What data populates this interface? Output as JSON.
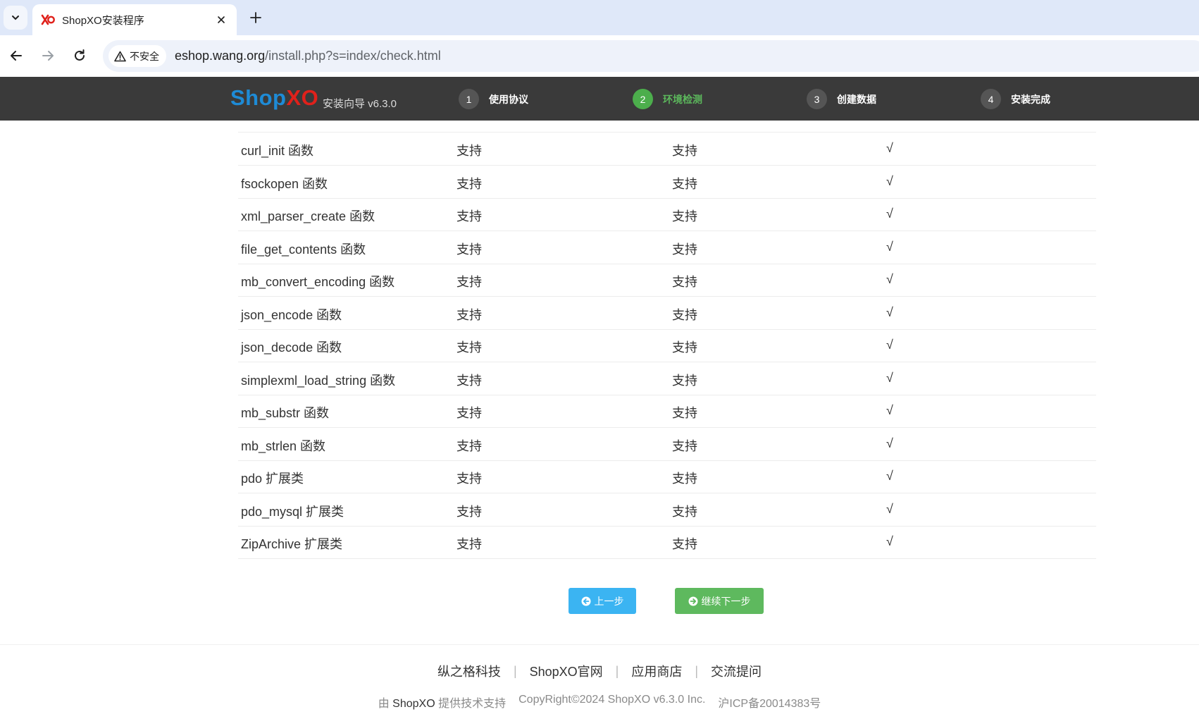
{
  "browser": {
    "tab_title": "ShopXO安装程序",
    "security_label": "不安全",
    "url_host": "eshop.wang.org",
    "url_path": "/install.php?s=index/check.html"
  },
  "header": {
    "logo_shop": "Shop",
    "logo_xo": "XO",
    "subtitle": "安装向导 v6.3.0",
    "steps": [
      {
        "num": "1",
        "label": "使用协议"
      },
      {
        "num": "2",
        "label": "环境检测"
      },
      {
        "num": "3",
        "label": "创建数据"
      },
      {
        "num": "4",
        "label": "安装完成"
      }
    ]
  },
  "table": {
    "rows": [
      {
        "name": "curl_init 函数",
        "required": "支持",
        "current": "支持",
        "status": "√"
      },
      {
        "name": "fsockopen 函数",
        "required": "支持",
        "current": "支持",
        "status": "√"
      },
      {
        "name": "xml_parser_create 函数",
        "required": "支持",
        "current": "支持",
        "status": "√"
      },
      {
        "name": "file_get_contents 函数",
        "required": "支持",
        "current": "支持",
        "status": "√"
      },
      {
        "name": "mb_convert_encoding 函数",
        "required": "支持",
        "current": "支持",
        "status": "√"
      },
      {
        "name": "json_encode 函数",
        "required": "支持",
        "current": "支持",
        "status": "√"
      },
      {
        "name": "json_decode 函数",
        "required": "支持",
        "current": "支持",
        "status": "√"
      },
      {
        "name": "simplexml_load_string 函数",
        "required": "支持",
        "current": "支持",
        "status": "√"
      },
      {
        "name": "mb_substr 函数",
        "required": "支持",
        "current": "支持",
        "status": "√"
      },
      {
        "name": "mb_strlen 函数",
        "required": "支持",
        "current": "支持",
        "status": "√"
      },
      {
        "name": "pdo 扩展类",
        "required": "支持",
        "current": "支持",
        "status": "√"
      },
      {
        "name": "pdo_mysql 扩展类",
        "required": "支持",
        "current": "支持",
        "status": "√"
      },
      {
        "name": "ZipArchive 扩展类",
        "required": "支持",
        "current": "支持",
        "status": "√"
      }
    ]
  },
  "buttons": {
    "prev": "上一步",
    "next": "继续下一步"
  },
  "footer": {
    "links": [
      "纵之格科技",
      "ShopXO官网",
      "应用商店",
      "交流提问"
    ],
    "separator": "|",
    "powered_prefix": "由",
    "powered_brand": "ShopXO",
    "powered_suffix": "提供技术支持",
    "copyright": "CopyRight©2024 ShopXO v6.3.0 Inc.",
    "icp": "沪ICP备20014383号"
  }
}
